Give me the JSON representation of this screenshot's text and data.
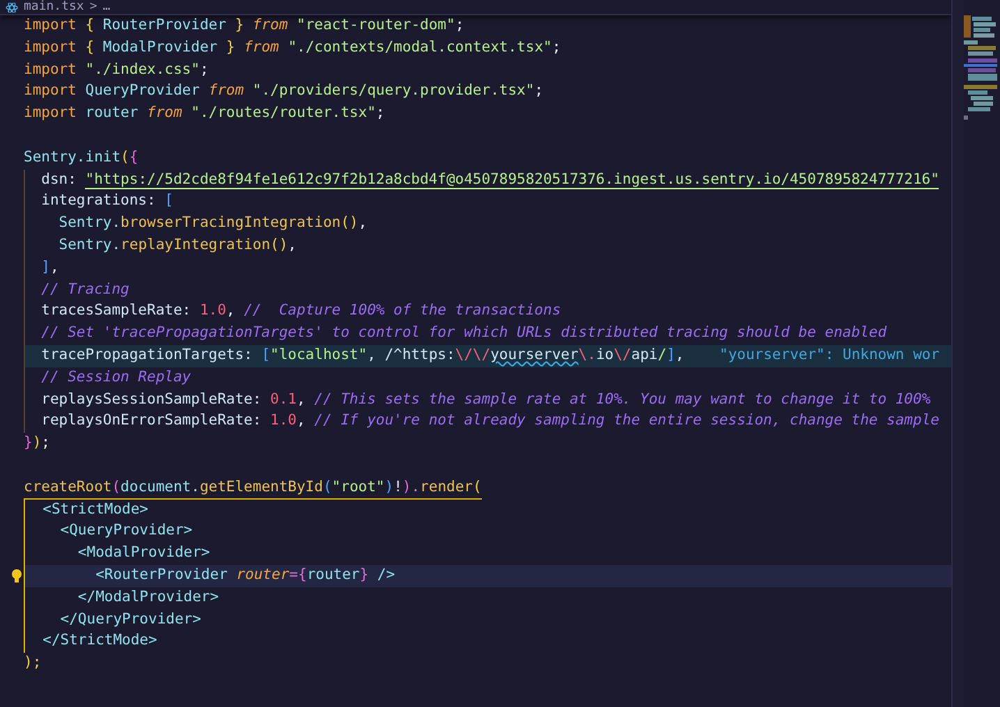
{
  "breadcrumb": {
    "file": "main.tsx",
    "separator": ">",
    "more": "…"
  },
  "lines": [
    {
      "selected": false,
      "hovered": false,
      "scope_guide": false,
      "active_guide": false,
      "tokens": [
        {
          "text": "import ",
          "kind": "keyword"
        },
        {
          "text": "{",
          "kind": "brace"
        },
        {
          "text": " RouterProvider ",
          "kind": "ident"
        },
        {
          "text": "}",
          "kind": "brace"
        },
        {
          "text": " from ",
          "kind": "keyword_italic"
        },
        {
          "text": "\"react-router-dom\"",
          "kind": "string"
        },
        {
          "text": ";",
          "kind": "punct"
        }
      ]
    },
    {
      "selected": false,
      "hovered": false,
      "scope_guide": false,
      "active_guide": false,
      "tokens": [
        {
          "text": "import ",
          "kind": "keyword"
        },
        {
          "text": "{",
          "kind": "brace"
        },
        {
          "text": " ModalProvider ",
          "kind": "ident"
        },
        {
          "text": "}",
          "kind": "brace"
        },
        {
          "text": " from ",
          "kind": "keyword_italic"
        },
        {
          "text": "\"./contexts/modal.context.tsx\"",
          "kind": "string"
        },
        {
          "text": ";",
          "kind": "punct"
        }
      ]
    },
    {
      "selected": false,
      "hovered": false,
      "scope_guide": false,
      "active_guide": false,
      "tokens": [
        {
          "text": "import ",
          "kind": "keyword"
        },
        {
          "text": "\"./index.css\"",
          "kind": "string"
        },
        {
          "text": ";",
          "kind": "punct"
        }
      ]
    },
    {
      "selected": false,
      "hovered": false,
      "scope_guide": false,
      "active_guide": false,
      "tokens": [
        {
          "text": "import ",
          "kind": "keyword"
        },
        {
          "text": "QueryProvider",
          "kind": "ident"
        },
        {
          "text": " from ",
          "kind": "keyword_italic"
        },
        {
          "text": "\"./providers/query.provider.tsx\"",
          "kind": "string"
        },
        {
          "text": ";",
          "kind": "punct"
        }
      ]
    },
    {
      "selected": false,
      "hovered": false,
      "scope_guide": false,
      "active_guide": false,
      "tokens": [
        {
          "text": "import ",
          "kind": "keyword"
        },
        {
          "text": "router",
          "kind": "ident"
        },
        {
          "text": " from ",
          "kind": "keyword_italic"
        },
        {
          "text": "\"./routes/router.tsx\"",
          "kind": "string"
        },
        {
          "text": ";",
          "kind": "punct"
        }
      ]
    },
    {
      "selected": false,
      "hovered": false,
      "scope_guide": false,
      "active_guide": false
    },
    {
      "selected": false,
      "hovered": false,
      "scope_guide": false,
      "active_guide": false,
      "tokens": [
        {
          "text": "Sentry.init",
          "kind": "ident"
        },
        {
          "text": "(",
          "kind": "brace"
        },
        {
          "text": "{",
          "kind": "pink"
        }
      ]
    },
    {
      "selected": false,
      "hovered": false,
      "scope_guide": true,
      "active_guide": false,
      "tokens": [
        {
          "text": "  dsn: ",
          "kind": "property"
        },
        {
          "text": "\"https://5d2cde8f94fe1e612c97f2b12a8cbd4f@o4507895820517376.ingest.us.sentry.io/4507895824777216\"",
          "kind": "string_underlined"
        }
      ]
    },
    {
      "selected": false,
      "hovered": false,
      "scope_guide": true,
      "active_guide": false,
      "tokens": [
        {
          "text": "  integrations: ",
          "kind": "property"
        },
        {
          "text": "[",
          "kind": "blue"
        }
      ]
    },
    {
      "selected": false,
      "hovered": false,
      "scope_guide": true,
      "active_guide": false,
      "tokens": [
        {
          "text": "    Sentry.",
          "kind": "ident"
        },
        {
          "text": "browserTracingIntegration",
          "kind": "func"
        },
        {
          "text": "()",
          "kind": "brace"
        },
        {
          "text": ",",
          "kind": "punct"
        }
      ]
    },
    {
      "selected": false,
      "hovered": false,
      "scope_guide": true,
      "active_guide": false,
      "tokens": [
        {
          "text": "    Sentry.",
          "kind": "ident"
        },
        {
          "text": "replayIntegration",
          "kind": "func"
        },
        {
          "text": "()",
          "kind": "brace"
        },
        {
          "text": ",",
          "kind": "punct"
        }
      ]
    },
    {
      "selected": false,
      "hovered": false,
      "scope_guide": true,
      "active_guide": false,
      "tokens": [
        {
          "text": "  ]",
          "kind": "blue"
        },
        {
          "text": ",",
          "kind": "punct"
        }
      ]
    },
    {
      "selected": false,
      "hovered": false,
      "scope_guide": true,
      "active_guide": false,
      "tokens": [
        {
          "text": "  // Tracing",
          "kind": "comment"
        }
      ]
    },
    {
      "selected": false,
      "hovered": false,
      "scope_guide": true,
      "active_guide": false,
      "tokens": [
        {
          "text": "  tracesSampleRate: ",
          "kind": "property"
        },
        {
          "text": "1.0",
          "kind": "number"
        },
        {
          "text": ", ",
          "kind": "punct"
        },
        {
          "text": "//  Capture 100% of the transactions",
          "kind": "comment"
        }
      ]
    },
    {
      "selected": false,
      "hovered": false,
      "scope_guide": true,
      "active_guide": false,
      "tokens": [
        {
          "text": "  // Set 'tracePropagationTargets' to control for which URLs distributed tracing should be enabled",
          "kind": "comment"
        }
      ]
    },
    {
      "selected": false,
      "hovered": true,
      "scope_guide": true,
      "active_guide": false,
      "tokens": [
        {
          "text": "  tracePropagationTargets: ",
          "kind": "property"
        },
        {
          "text": "[",
          "kind": "blue"
        },
        {
          "text": "\"localhost\"",
          "kind": "string"
        },
        {
          "text": ", /^https:",
          "kind": "property"
        },
        {
          "text": "\\/\\/",
          "kind": "number"
        },
        {
          "text": "yourserver",
          "kind": "misspelled"
        },
        {
          "text": "\\.",
          "kind": "number"
        },
        {
          "text": "io",
          "kind": "property"
        },
        {
          "text": "\\/",
          "kind": "number"
        },
        {
          "text": "api",
          "kind": "property"
        },
        {
          "text": "/",
          "kind": "string"
        },
        {
          "text": "]",
          "kind": "blue"
        },
        {
          "text": ",",
          "kind": "punct"
        },
        {
          "text": "    \"yourserver\": Unknown wor",
          "kind": "hint"
        }
      ]
    },
    {
      "selected": false,
      "hovered": false,
      "scope_guide": true,
      "active_guide": false,
      "tokens": [
        {
          "text": "  // Session Replay",
          "kind": "comment"
        }
      ]
    },
    {
      "selected": false,
      "hovered": false,
      "scope_guide": true,
      "active_guide": false,
      "tokens": [
        {
          "text": "  replaysSessionSampleRate: ",
          "kind": "property"
        },
        {
          "text": "0.1",
          "kind": "number"
        },
        {
          "text": ", ",
          "kind": "punct"
        },
        {
          "text": "// This sets the sample rate at 10%. You may want to change it to 100%",
          "kind": "comment"
        }
      ]
    },
    {
      "selected": false,
      "hovered": false,
      "scope_guide": true,
      "active_guide": false,
      "tokens": [
        {
          "text": "  replaysOnErrorSampleRate: ",
          "kind": "property"
        },
        {
          "text": "1.0",
          "kind": "number"
        },
        {
          "text": ", ",
          "kind": "punct"
        },
        {
          "text": "// If you're not already sampling the entire session, change the sample",
          "kind": "comment"
        }
      ]
    },
    {
      "selected": false,
      "hovered": false,
      "scope_guide": false,
      "active_guide": false,
      "tokens": [
        {
          "text": "}",
          "kind": "pink"
        },
        {
          "text": ")",
          "kind": "brace"
        },
        {
          "text": ";",
          "kind": "punct"
        }
      ]
    },
    {
      "selected": false,
      "hovered": false,
      "scope_guide": false,
      "active_guide": false
    },
    {
      "selected": false,
      "hovered": false,
      "scope_guide": false,
      "active_guide": false,
      "active_start": true,
      "tokens": [
        {
          "text": "createRoot",
          "kind": "func"
        },
        {
          "text": "(",
          "kind": "pink"
        },
        {
          "text": "document.",
          "kind": "ident"
        },
        {
          "text": "getElementById",
          "kind": "func"
        },
        {
          "text": "(",
          "kind": "blue"
        },
        {
          "text": "\"root\"",
          "kind": "string"
        },
        {
          "text": ")",
          "kind": "blue"
        },
        {
          "text": "!",
          "kind": "punct"
        },
        {
          "text": ").",
          "kind": "pink"
        },
        {
          "text": "render",
          "kind": "func"
        },
        {
          "text": "(",
          "kind": "brace"
        }
      ]
    },
    {
      "selected": false,
      "hovered": false,
      "scope_guide": false,
      "active_guide": true,
      "tokens": [
        {
          "text": "  <StrictMode>",
          "kind": "tag"
        }
      ]
    },
    {
      "selected": false,
      "hovered": false,
      "scope_guide": false,
      "active_guide": true,
      "tokens": [
        {
          "text": "    <QueryProvider>",
          "kind": "tag"
        }
      ]
    },
    {
      "selected": false,
      "hovered": false,
      "scope_guide": false,
      "active_guide": true,
      "tokens": [
        {
          "text": "      <ModalProvider>",
          "kind": "tag"
        }
      ]
    },
    {
      "selected": true,
      "hovered": false,
      "scope_guide": false,
      "active_guide": true,
      "lightbulb": true,
      "tokens": [
        {
          "text": "        <RouterProvider ",
          "kind": "tag"
        },
        {
          "text": "router",
          "kind": "keyword_italic"
        },
        {
          "text": "={",
          "kind": "pink"
        },
        {
          "text": "router",
          "kind": "ident"
        },
        {
          "text": "}",
          "kind": "pink"
        },
        {
          "text": " />",
          "kind": "tag"
        }
      ]
    },
    {
      "selected": false,
      "hovered": false,
      "scope_guide": false,
      "active_guide": true,
      "tokens": [
        {
          "text": "      </ModalProvider>",
          "kind": "tag"
        }
      ]
    },
    {
      "selected": false,
      "hovered": false,
      "scope_guide": false,
      "active_guide": true,
      "tokens": [
        {
          "text": "    </QueryProvider>",
          "kind": "tag"
        }
      ]
    },
    {
      "selected": false,
      "hovered": false,
      "scope_guide": false,
      "active_guide": true,
      "tokens": [
        {
          "text": "  </StrictMode>",
          "kind": "tag"
        }
      ]
    },
    {
      "selected": false,
      "hovered": false,
      "scope_guide": false,
      "active_guide": false,
      "tokens": [
        {
          "text": ");",
          "kind": "brace"
        }
      ]
    }
  ]
}
